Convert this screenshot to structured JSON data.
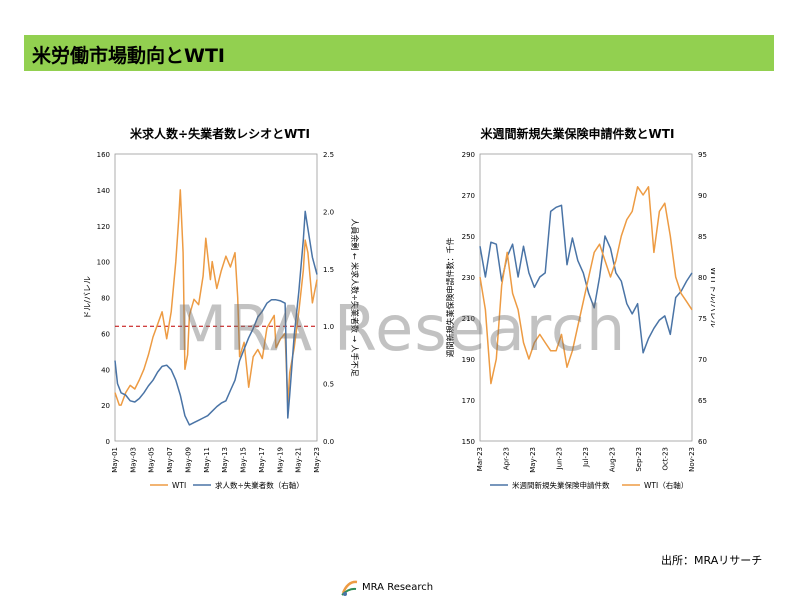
{
  "header": {
    "title": "米労働市場動向とWTI"
  },
  "watermark": "MRA Research",
  "source": "出所：MRAリサーチ",
  "logo": {
    "text": "MRA Research"
  },
  "colors": {
    "header_bg": "#92d050",
    "orange": "#ed9b43",
    "blue": "#4a74a6",
    "ref_line": "#c00000"
  },
  "chart_data": [
    {
      "type": "line",
      "title": "米求人数÷失業者数レシオとWTI",
      "ylabel_left": "ドル/バレル",
      "ylabel_right": "人員余剰 ← 米求人数÷失業者数 → 人手不足",
      "ylim_left": [
        0,
        160
      ],
      "ylim_right": [
        0.0,
        2.5
      ],
      "yticks_left": [
        "0",
        "20",
        "40",
        "60",
        "80",
        "100",
        "120",
        "140",
        "160"
      ],
      "yticks_right": [
        "0.0",
        "0.5",
        "1.0",
        "1.5",
        "2.0",
        "2.5"
      ],
      "xlim": [
        2001.33,
        2023.5
      ],
      "xticks": [
        "May-01",
        "May-03",
        "May-05",
        "May-07",
        "May-09",
        "May-11",
        "May-13",
        "May-15",
        "May-17",
        "May-19",
        "May-21",
        "May-23"
      ],
      "reference_line": {
        "axis": "right",
        "value": 1.0
      },
      "legend": "bottom",
      "series": [
        {
          "name": "WTI",
          "axis": "left",
          "color": "#ed9b43",
          "x": [
            2001.33,
            2001.8,
            2002.0,
            2002.5,
            2003.0,
            2003.5,
            2004.0,
            2004.5,
            2005.0,
            2005.5,
            2006.0,
            2006.5,
            2007.0,
            2007.5,
            2008.0,
            2008.3,
            2008.5,
            2008.8,
            2009.0,
            2009.3,
            2009.5,
            2010.0,
            2010.5,
            2011.0,
            2011.3,
            2011.8,
            2012.0,
            2012.5,
            2013.0,
            2013.5,
            2014.0,
            2014.5,
            2014.8,
            2015.0,
            2015.5,
            2016.0,
            2016.5,
            2017.0,
            2017.5,
            2018.0,
            2018.8,
            2019.0,
            2019.5,
            2020.0,
            2020.3,
            2020.5,
            2021.0,
            2021.5,
            2022.0,
            2022.2,
            2022.5,
            2023.0,
            2023.5
          ],
          "y": [
            27,
            20,
            20,
            27,
            31,
            29,
            34,
            40,
            48,
            58,
            65,
            72,
            57,
            72,
            100,
            122,
            140,
            105,
            40,
            48,
            70,
            79,
            76,
            92,
            113,
            90,
            100,
            85,
            95,
            103,
            97,
            105,
            80,
            47,
            55,
            30,
            47,
            51,
            46,
            63,
            70,
            52,
            57,
            60,
            20,
            38,
            52,
            72,
            95,
            112,
            105,
            77,
            90
          ]
        },
        {
          "name": "求人数÷失業者数（右軸）",
          "axis": "right",
          "color": "#4a74a6",
          "x": [
            2001.33,
            2001.6,
            2002.0,
            2002.5,
            2003.0,
            2003.5,
            2004.0,
            2004.5,
            2005.0,
            2005.5,
            2006.0,
            2006.5,
            2007.0,
            2007.5,
            2008.0,
            2008.5,
            2009.0,
            2009.5,
            2010.0,
            2010.5,
            2011.0,
            2011.5,
            2012.0,
            2012.5,
            2013.0,
            2013.5,
            2014.0,
            2014.5,
            2015.0,
            2015.5,
            2016.0,
            2016.5,
            2017.0,
            2017.5,
            2018.0,
            2018.5,
            2019.0,
            2019.5,
            2020.0,
            2020.3,
            2020.5,
            2021.0,
            2021.5,
            2022.0,
            2022.2,
            2022.5,
            2023.0,
            2023.5
          ],
          "y": [
            0.7,
            0.5,
            0.42,
            0.4,
            0.35,
            0.34,
            0.37,
            0.42,
            0.48,
            0.53,
            0.6,
            0.65,
            0.66,
            0.62,
            0.53,
            0.4,
            0.22,
            0.14,
            0.16,
            0.18,
            0.2,
            0.22,
            0.26,
            0.3,
            0.33,
            0.35,
            0.44,
            0.53,
            0.7,
            0.8,
            0.9,
            0.98,
            1.08,
            1.13,
            1.2,
            1.23,
            1.23,
            1.22,
            1.2,
            0.2,
            0.4,
            0.92,
            1.3,
            1.75,
            2.0,
            1.85,
            1.6,
            1.45
          ]
        }
      ]
    },
    {
      "type": "line",
      "title": "米週間新規失業保険申請件数とWTI",
      "ylabel_left": "週間新規失業保険申請件数：千件",
      "ylabel_right": "WTI ドル/バレル",
      "ylim_left": [
        150,
        290
      ],
      "ylim_right": [
        60,
        95
      ],
      "yticks_left": [
        "150",
        "170",
        "190",
        "210",
        "230",
        "250",
        "270",
        "290"
      ],
      "yticks_right": [
        "60",
        "65",
        "70",
        "75",
        "80",
        "85",
        "90",
        "95"
      ],
      "xlim": [
        0,
        1
      ],
      "xticks": [
        "Mar-23",
        "Apr-23",
        "May-23",
        "Jun-23",
        "Jul-23",
        "Aug-23",
        "Sep-23",
        "Oct-23",
        "Nov-23"
      ],
      "legend": "bottom",
      "series": [
        {
          "name": "米週間新規失業保険申請件数",
          "axis": "left",
          "color": "#4a74a6",
          "y": [
            245,
            230,
            247,
            246,
            228,
            240,
            246,
            230,
            245,
            232,
            225,
            230,
            232,
            262,
            264,
            265,
            236,
            249,
            238,
            232,
            222,
            215,
            230,
            250,
            244,
            232,
            228,
            217,
            212,
            217,
            193,
            200,
            205,
            209,
            211,
            202,
            220,
            223,
            228,
            232
          ]
        },
        {
          "name": "WTI（右軸）",
          "axis": "right",
          "color": "#ed9b43",
          "y": [
            80,
            76,
            67,
            70,
            79,
            83,
            78,
            76,
            72,
            70,
            72,
            73,
            72,
            71,
            71,
            73,
            69,
            71,
            74,
            77,
            80,
            83,
            84,
            82,
            80,
            82,
            85,
            87,
            88,
            91,
            90,
            91,
            83,
            88,
            89,
            85,
            80,
            78,
            77,
            76
          ]
        }
      ]
    }
  ]
}
